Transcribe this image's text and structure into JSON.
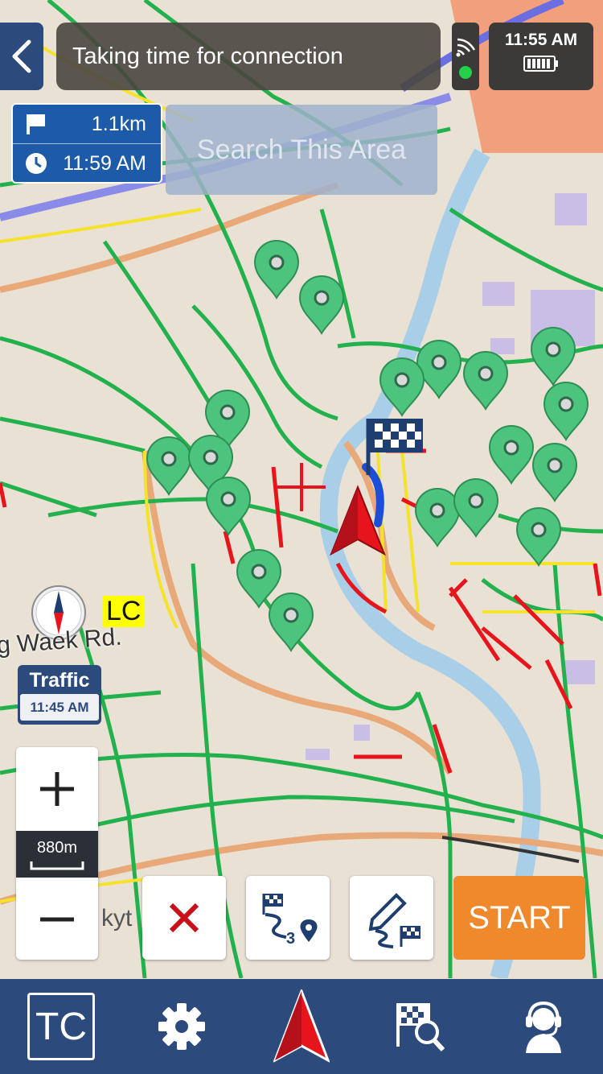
{
  "status": {
    "connection_message": "Taking time for connection",
    "clock": "11:55 AM"
  },
  "route": {
    "distance": "1.1km",
    "eta": "11:59 AM"
  },
  "search": {
    "button_label": "Search This Area"
  },
  "map": {
    "poi_label": "LC",
    "road_label": "g Waek Rd.",
    "bottom_road_fragment": "kyt",
    "traffic_label": "Traffic",
    "traffic_time": "11:45 AM",
    "scale": "880m"
  },
  "toolbar": {
    "start_label": "START",
    "cancel_icon": "close-icon",
    "waypoints_icon": "route-waypoints-icon",
    "edit_route_icon": "edit-route-icon"
  },
  "nav": {
    "tc_label": "TC",
    "items": [
      "settings-icon",
      "navigation-arrow-icon",
      "route-search-icon",
      "support-icon"
    ]
  },
  "colors": {
    "nav_blue": "#2c4a7c",
    "route_info_blue": "#1d5aa8",
    "start_orange": "#f0892c",
    "traffic_green": "#22b14c",
    "traffic_red": "#e8141c",
    "traffic_yellow": "#f5e22a",
    "poi_green": "#4dc47e"
  }
}
